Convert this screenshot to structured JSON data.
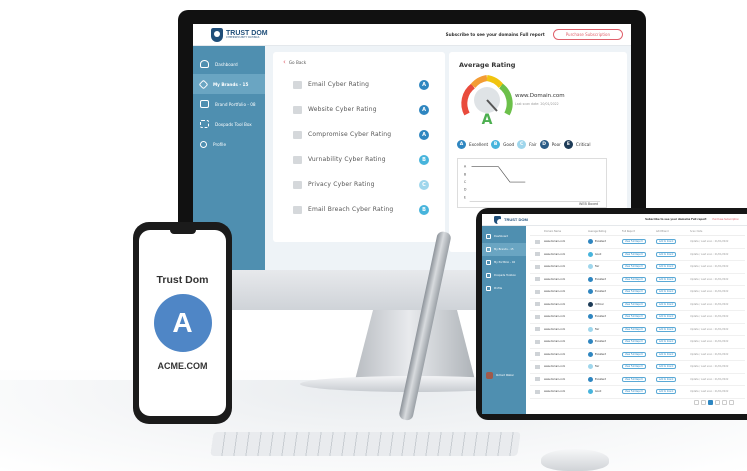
{
  "app": {
    "brand_main": "TRUST DOM",
    "brand_sub": "CYBERSECURITY RATINGS"
  },
  "header": {
    "subscribe_text": "Subscribe to see your domains Full report",
    "purchase_label": "Purchase Subscription"
  },
  "sidebar": {
    "items": [
      {
        "label": "Dashboard",
        "icon": "gauge-icon"
      },
      {
        "label": "My Brands - 15",
        "icon": "tag-icon"
      },
      {
        "label": "Brand Portfolio - 08",
        "icon": "portfolio-icon"
      },
      {
        "label": "Doxpads Tool Box",
        "icon": "toolbox-icon"
      },
      {
        "label": "Profile",
        "icon": "user-icon"
      }
    ]
  },
  "ratings": {
    "go_back": "Go Back",
    "items": [
      {
        "label": "Email Cyber Rating",
        "grade": "A",
        "color": "#2f86c0"
      },
      {
        "label": "Website Cyber Rating",
        "grade": "A",
        "color": "#2f86c0"
      },
      {
        "label": "Compromise Cyber Rating",
        "grade": "A",
        "color": "#2f86c0"
      },
      {
        "label": "Vurnability Cyber Rating",
        "grade": "B",
        "color": "#47b4dc"
      },
      {
        "label": "Privacy Cyber Rating",
        "grade": "C",
        "color": "#9fd6ec"
      },
      {
        "label": "Email Breach Cyber Rating",
        "grade": "B",
        "color": "#47b4dc"
      }
    ]
  },
  "average": {
    "title": "Average Rating",
    "grade": "A",
    "domain": "www.Domain.com",
    "last_scan": "Last scan date: 20/01/2022",
    "legend": [
      {
        "grade": "A",
        "label": "Excellent",
        "color": "#2f86c0"
      },
      {
        "grade": "B",
        "label": "Good",
        "color": "#47b4dc"
      },
      {
        "grade": "C",
        "label": "Fair",
        "color": "#9fd6ec"
      },
      {
        "grade": "D",
        "label": "Poor",
        "color": "#2a5b86"
      },
      {
        "grade": "E",
        "label": "Critical",
        "color": "#1d3b57"
      }
    ],
    "mini_chart": {
      "y_ticks": [
        "A",
        "B",
        "C",
        "D",
        "E"
      ],
      "footer": "WEB Boxed"
    }
  },
  "phone": {
    "brand": "Trust Dom",
    "grade": "A",
    "grade_color": "#4f86c6",
    "domain": "ACME.COM"
  },
  "tablet": {
    "subscribe_text": "Subscribe to see your domains Full report",
    "purchase_label": "Purchase Subscription",
    "side_items": [
      "Dashboard",
      "My Brands - 15",
      "My Portfolio - 02",
      "Doxpads Toolbox",
      "Profile"
    ],
    "user": "Richard Walker",
    "columns": [
      "Domain Name",
      "Average Rating",
      "Full Report",
      "Add Brand",
      "Scan Date"
    ],
    "rows": [
      {
        "domain": "www.domain.com",
        "rating": "Excellent",
        "color": "#2f86c0"
      },
      {
        "domain": "www.domain.com",
        "rating": "Good",
        "color": "#47b4dc"
      },
      {
        "domain": "www.domain.com",
        "rating": "Fair",
        "color": "#9fd6ec"
      },
      {
        "domain": "www.domain.com",
        "rating": "Excellent",
        "color": "#2f86c0"
      },
      {
        "domain": "www.domain.com",
        "rating": "Excellent",
        "color": "#2f86c0"
      },
      {
        "domain": "www.domain.com",
        "rating": "Critical",
        "color": "#1d3b57"
      },
      {
        "domain": "www.domain.com",
        "rating": "Excellent",
        "color": "#2f86c0"
      },
      {
        "domain": "www.domain.com",
        "rating": "Fair",
        "color": "#9fd6ec"
      },
      {
        "domain": "www.domain.com",
        "rating": "Excellent",
        "color": "#2f86c0"
      },
      {
        "domain": "www.domain.com",
        "rating": "Excellent",
        "color": "#2f86c0"
      },
      {
        "domain": "www.domain.com",
        "rating": "Fair",
        "color": "#9fd6ec"
      },
      {
        "domain": "www.domain.com",
        "rating": "Excellent",
        "color": "#2f86c0"
      },
      {
        "domain": "www.domain.com",
        "rating": "Good",
        "color": "#47b4dc"
      }
    ],
    "row_report_label": "View Full Report",
    "row_add_label": "Add to brand",
    "row_scan_label": "Update / Last scan : 21/01/2022"
  }
}
